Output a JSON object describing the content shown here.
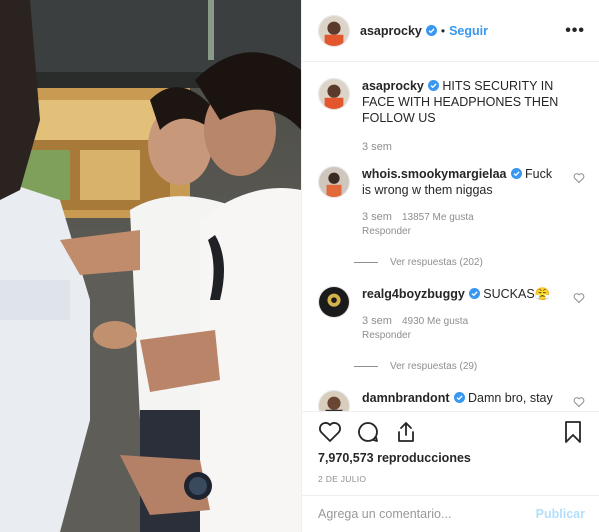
{
  "post": {
    "username": "asaprocky",
    "dot": "•",
    "follow_label": "Seguir",
    "more_label": "•••",
    "caption_user": "asaprocky",
    "caption_text": "HITS SECURITY IN FACE WITH HEADPHONES THEN FOLLOW US",
    "caption_time": "3 sem"
  },
  "comments": [
    {
      "user": "whois.smookymargielaa",
      "text": "Fuck is wrong w them niggas",
      "time": "3 sem",
      "likes": "13857 Me gusta",
      "reply": "Responder",
      "replies": "Ver respuestas (202)"
    },
    {
      "user": "realg4boyzbuggy",
      "text": "SUCKAS😤",
      "time": "3 sem",
      "likes": "4930 Me gusta",
      "reply": "Responder",
      "replies": "Ver respuestas (29)"
    },
    {
      "user": "damnbrandont",
      "text": "Damn bro, stay"
    }
  ],
  "stats": {
    "views": "7,970,573 reproducciones",
    "date": "2 DE JULIO"
  },
  "composer": {
    "placeholder": "Agrega un comentario...",
    "publish_label": "Publicar"
  },
  "colors": {
    "accent": "#3897f0",
    "verified": "#3897f0",
    "muted": "#8e8e8e",
    "publish_disabled": "#b2dffc"
  }
}
